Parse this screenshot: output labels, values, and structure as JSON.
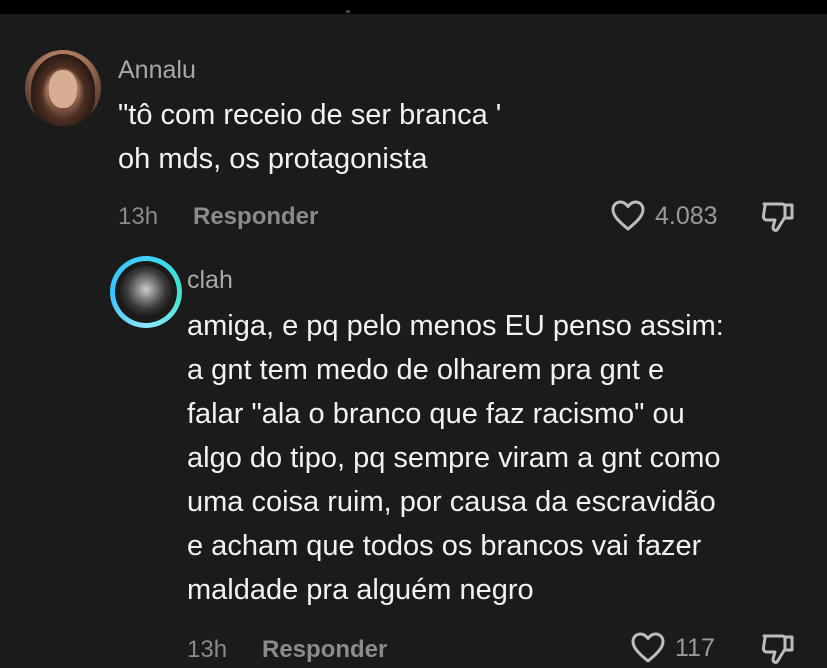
{
  "comment1": {
    "username": "Annalu",
    "lines": [
      "\"tô com receio de ser branca '",
      "oh mds, os protagonista"
    ],
    "time": "13h",
    "reply_label": "Responder",
    "likes": "4.083"
  },
  "comment2": {
    "username": "clah",
    "lines": [
      "amiga, e pq pelo menos EU penso assim:",
      "a gnt tem medo de olharem pra gnt e",
      "falar \"ala o branco que faz racismo\" ou",
      "algo do tipo, pq sempre viram a gnt como",
      "uma coisa ruim, por causa da escravidão",
      "e acham que todos os brancos vai fazer",
      "maldade pra alguém negro"
    ],
    "time": "13h",
    "reply_label": "Responder",
    "likes": "117"
  },
  "icons": {
    "like": "heart-outline-icon",
    "dislike": "thumbs-down-icon"
  },
  "colors": {
    "background": "#1b1b1b",
    "text": "#f2f2f2",
    "muted": "#8b8b8b",
    "story_ring": "#3fd3ff"
  }
}
